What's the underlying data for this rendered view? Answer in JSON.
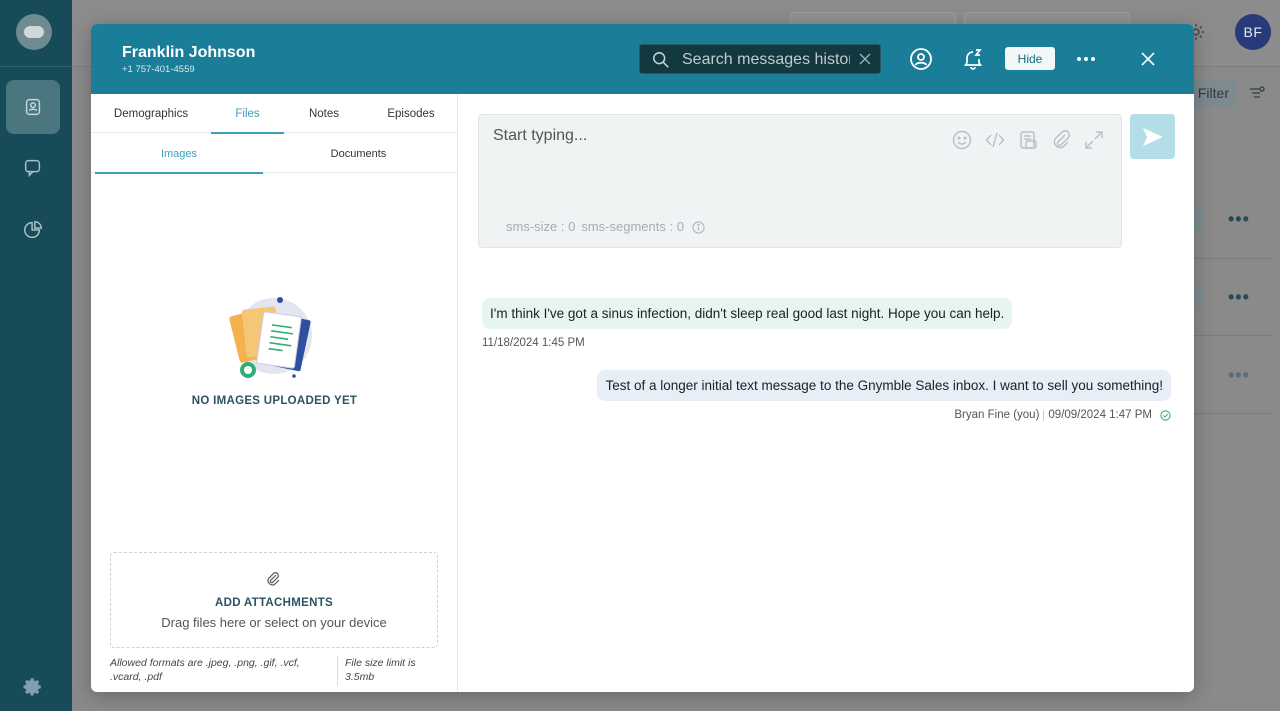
{
  "user": {
    "initials": "BF"
  },
  "background": {
    "filter_label": "Filter"
  },
  "contact": {
    "name": "Franklin Johnson",
    "phone": "+1 757-401-4559"
  },
  "header": {
    "search_placeholder": "Search messages history",
    "hide_label": "Hide"
  },
  "tabs": [
    {
      "label": "Demographics",
      "active": false
    },
    {
      "label": "Files",
      "active": true
    },
    {
      "label": "Notes",
      "active": false
    },
    {
      "label": "Episodes",
      "active": false
    }
  ],
  "subtabs": [
    {
      "label": "Images",
      "active": true
    },
    {
      "label": "Documents",
      "active": false
    }
  ],
  "files": {
    "empty_text": "NO IMAGES UPLOADED YET",
    "dropzone_title": "ADD ATTACHMENTS",
    "dropzone_sub": "Drag files here or select on your device",
    "formats": "Allowed formats are .jpeg, .png, .gif, .vcf, .vcard, .pdf",
    "size_limit": "File size limit is 3.5mb"
  },
  "composer": {
    "placeholder": "Start typing...",
    "sms_size": "sms-size : 0",
    "sms_segments": "sms-segments : 0"
  },
  "messages": [
    {
      "direction": "in",
      "text": "I'm think I've got a sinus infection, didn't sleep real good last night. Hope you can help.",
      "time": "11/18/2024 1:45 PM"
    },
    {
      "direction": "out",
      "text": "Test of a longer initial text message to the Gnymble Sales inbox. I want to sell you something!",
      "sender": "Bryan Fine (you)",
      "time": "09/09/2024 1:47 PM"
    }
  ],
  "colors": {
    "header": "#1a7e98",
    "rail": "#174b58",
    "accent": "#3f9fb7"
  }
}
